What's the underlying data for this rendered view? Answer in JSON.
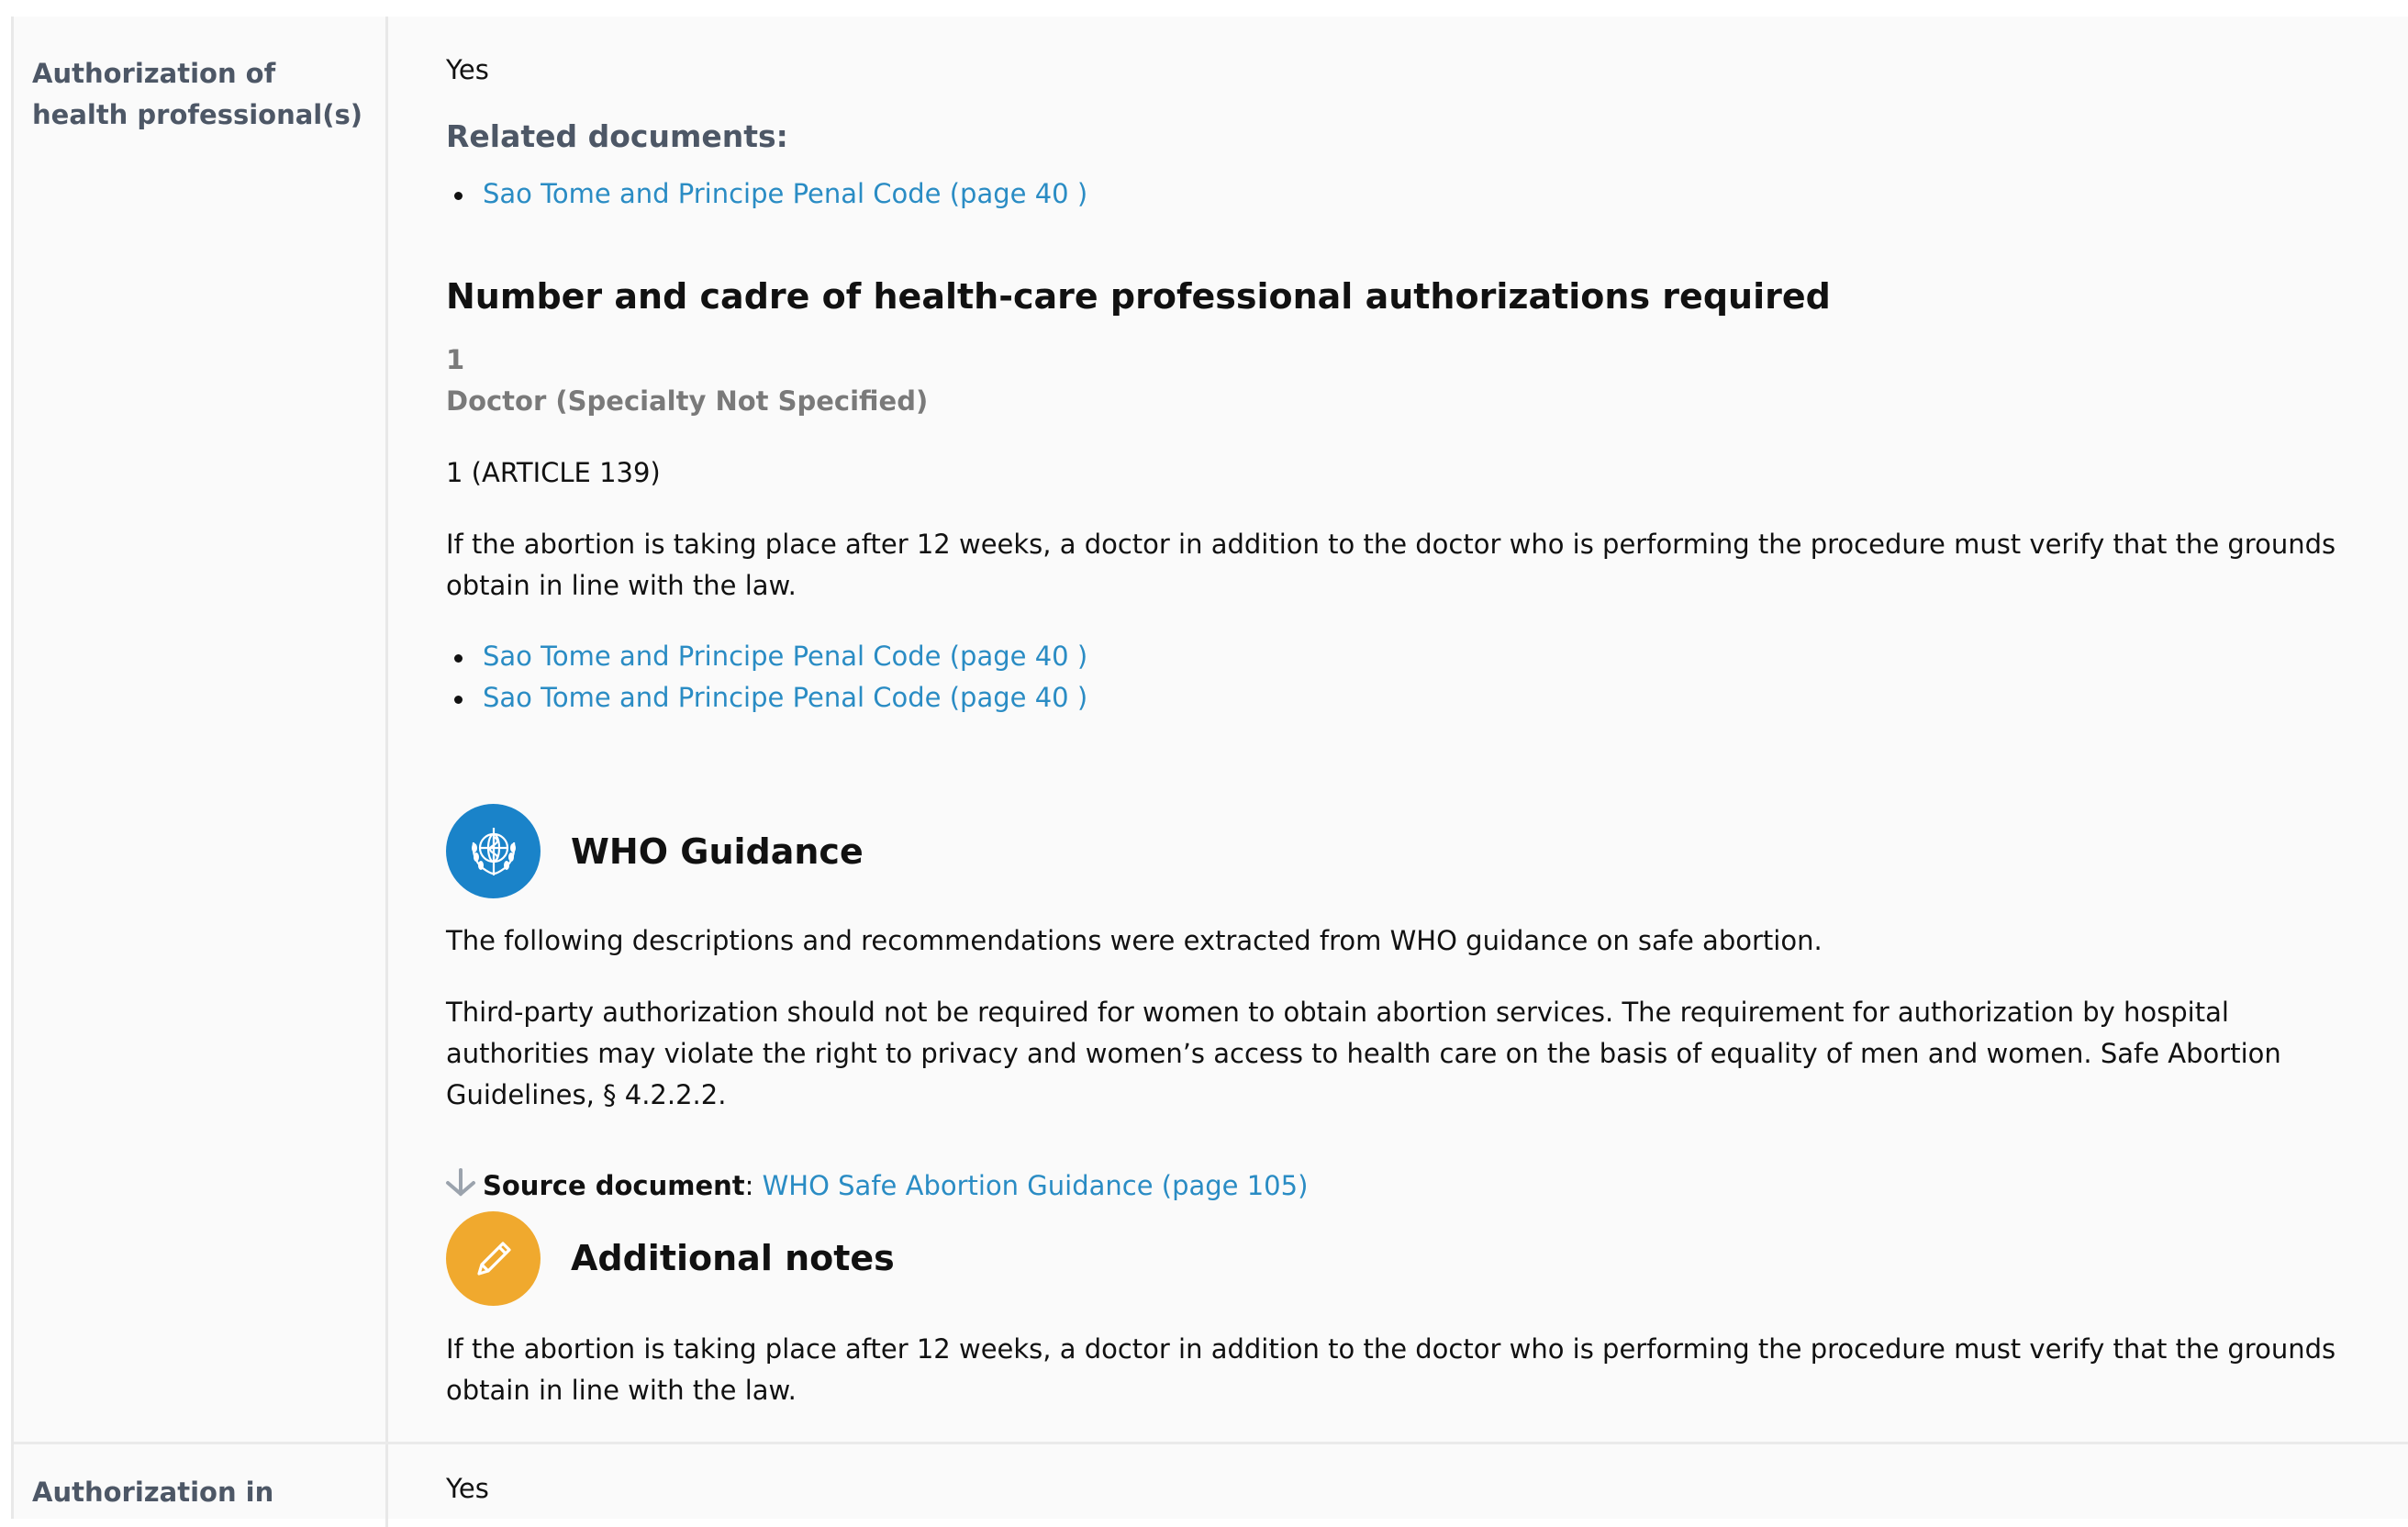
{
  "rows": [
    {
      "label": "Authorization of health professional(s)",
      "value": "Yes",
      "related_heading": "Related documents:",
      "related_links": [
        "Sao Tome and Principe Penal Code (page 40 )"
      ],
      "section_title": "Number and cadre of health-care professional authorizations required",
      "count": "1",
      "cadre": "Doctor (Specialty Not Specified)",
      "article": "1 (ARTICLE 139)",
      "explanation": "If the abortion is taking place after 12 weeks, a doctor in addition to the doctor who is performing the procedure must verify that the grounds obtain in line with the law.",
      "explanation_links": [
        "Sao Tome and Principe Penal Code (page 40 )",
        "Sao Tome and Principe Penal Code (page 40 )"
      ],
      "who_guidance": {
        "icon": "who-emblem-icon",
        "title": "WHO Guidance",
        "intro": "The following descriptions and recommendations were extracted from WHO guidance on safe abortion.",
        "body": "Third-party authorization should not be required for women to obtain abortion services. The requirement for authorization by hospital authorities may violate the right to privacy and women’s access to health care on the basis of equality of men and women. Safe Abortion Guidelines, § 4.2.2.2.",
        "source_label": "Source document",
        "source_link": "WHO Safe Abortion Guidance (page 105)"
      },
      "additional_notes": {
        "icon": "pencil-icon",
        "title": "Additional notes",
        "body": "If the abortion is taking place after 12 weeks, a doctor in addition to the doctor who is performing the procedure must verify that the grounds obtain in line with the law."
      }
    },
    {
      "label": "Authorization in",
      "value": "Yes"
    }
  ],
  "colors": {
    "link": "#2a8cc4",
    "label": "#4d5766",
    "who_blue": "#1a83c9",
    "notes_orange": "#f0a92e"
  }
}
